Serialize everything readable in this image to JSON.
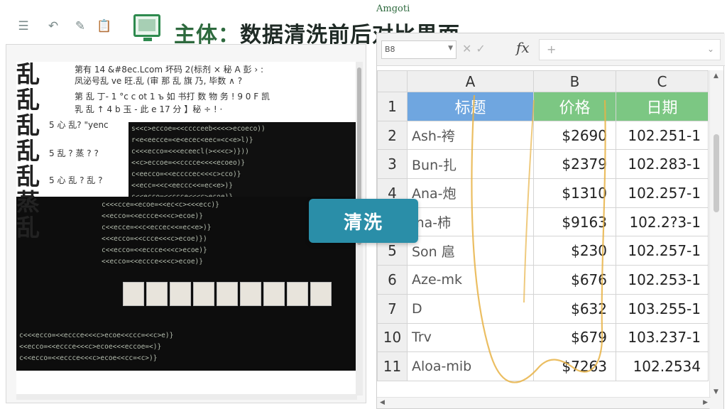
{
  "toolbar": {
    "brand": "Amgoti",
    "title_main": "主体：",
    "title_sub": "数据清洗前后对比界面"
  },
  "left_panel": {
    "messy_chars": [
      "乱 乱",
      "乱 乱",
      "乱",
      "蒸",
      "乱"
    ],
    "messy_lines": [
      "第有 14 &#8ec.Lcom 坏码 2(标剂 × 秘 A 彭 › :",
      "凤泌号乱 ve 旺.乱 (审 那 乱 旗 乃, 毕数 ∧ ?",
      "第 乱 丁- 1 °c c ot 1 ъ 如 书打 数 物 务 !  9 0 F 凯",
      "乳 乱 ↑ 4 b 玉 - 此 e 17 分 】秘 ÷ ! ·",
      "5 心 乱? \"yenc",
      "5 乱 ? 蒸 ? ?",
      "5 心 乱 ? 乱 ?"
    ]
  },
  "clean_button": {
    "label": "清洗"
  },
  "sheet": {
    "name_box": "B8",
    "fx": "fx",
    "columns": [
      "A",
      "B",
      "C"
    ],
    "header_row": {
      "num": "1",
      "a": "标题",
      "b": "价格",
      "c": "日期"
    },
    "rows": [
      {
        "num": "2",
        "a": "Ash-袴",
        "b": "$2690",
        "c": "102.251-1"
      },
      {
        "num": "3",
        "a": "Bun-扎",
        "b": "$2379",
        "c": "102.283-1"
      },
      {
        "num": "4",
        "a": "Ana-炮",
        "b": "$1310",
        "c": "102.257-1"
      },
      {
        "num": "5",
        "a": "Ina-柿",
        "b": "$9163",
        "c": "102.2?3-1"
      },
      {
        "num": "5",
        "a": "Son 扈",
        "b": "$230",
        "c": "102.257-1"
      },
      {
        "num": "6",
        "a": "Aze-mk",
        "b": "$676",
        "c": "102.253-1"
      },
      {
        "num": "7",
        "a": "D",
        "b": "$632",
        "c": "103.255-1"
      },
      {
        "num": "10",
        "a": "Trv",
        "b": "$679",
        "c": "103.237-1"
      },
      {
        "num": "11",
        "a": "Aloa-mib",
        "b": "$7263",
        "c": "102.2534"
      }
    ]
  },
  "colors": {
    "accent_button": "#2a8ea8",
    "header_blue": "#6fa6e0",
    "header_green": "#7cc783",
    "trace_line": "#e8b347",
    "brand_green": "#2e8a4e"
  }
}
